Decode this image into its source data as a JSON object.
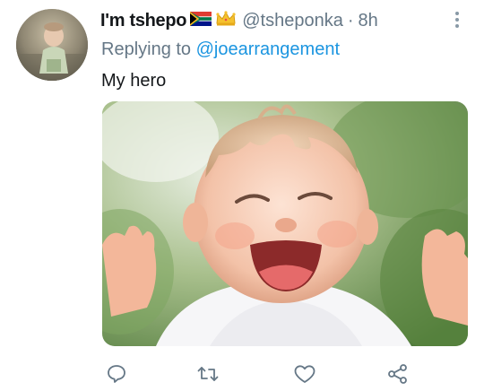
{
  "tweet": {
    "display_name": "I'm tshepo",
    "name_emojis": [
      "south-africa-flag-icon",
      "crown-icon"
    ],
    "handle": "@tsheponka",
    "separator": "·",
    "timestamp": "8h",
    "reply_prefix": "Replying to",
    "reply_to": "@joearrangement",
    "text": "My hero",
    "media_description": "laughing-baby-photo"
  },
  "actions": [
    {
      "name": "reply-button",
      "icon": "comment-icon"
    },
    {
      "name": "retweet-button",
      "icon": "retweet-icon"
    },
    {
      "name": "like-button",
      "icon": "heart-icon"
    },
    {
      "name": "share-button",
      "icon": "share-icon"
    }
  ],
  "colors": {
    "text_primary": "#14171a",
    "text_secondary": "#657786",
    "link": "#1b95e0",
    "icon": "#657786"
  }
}
